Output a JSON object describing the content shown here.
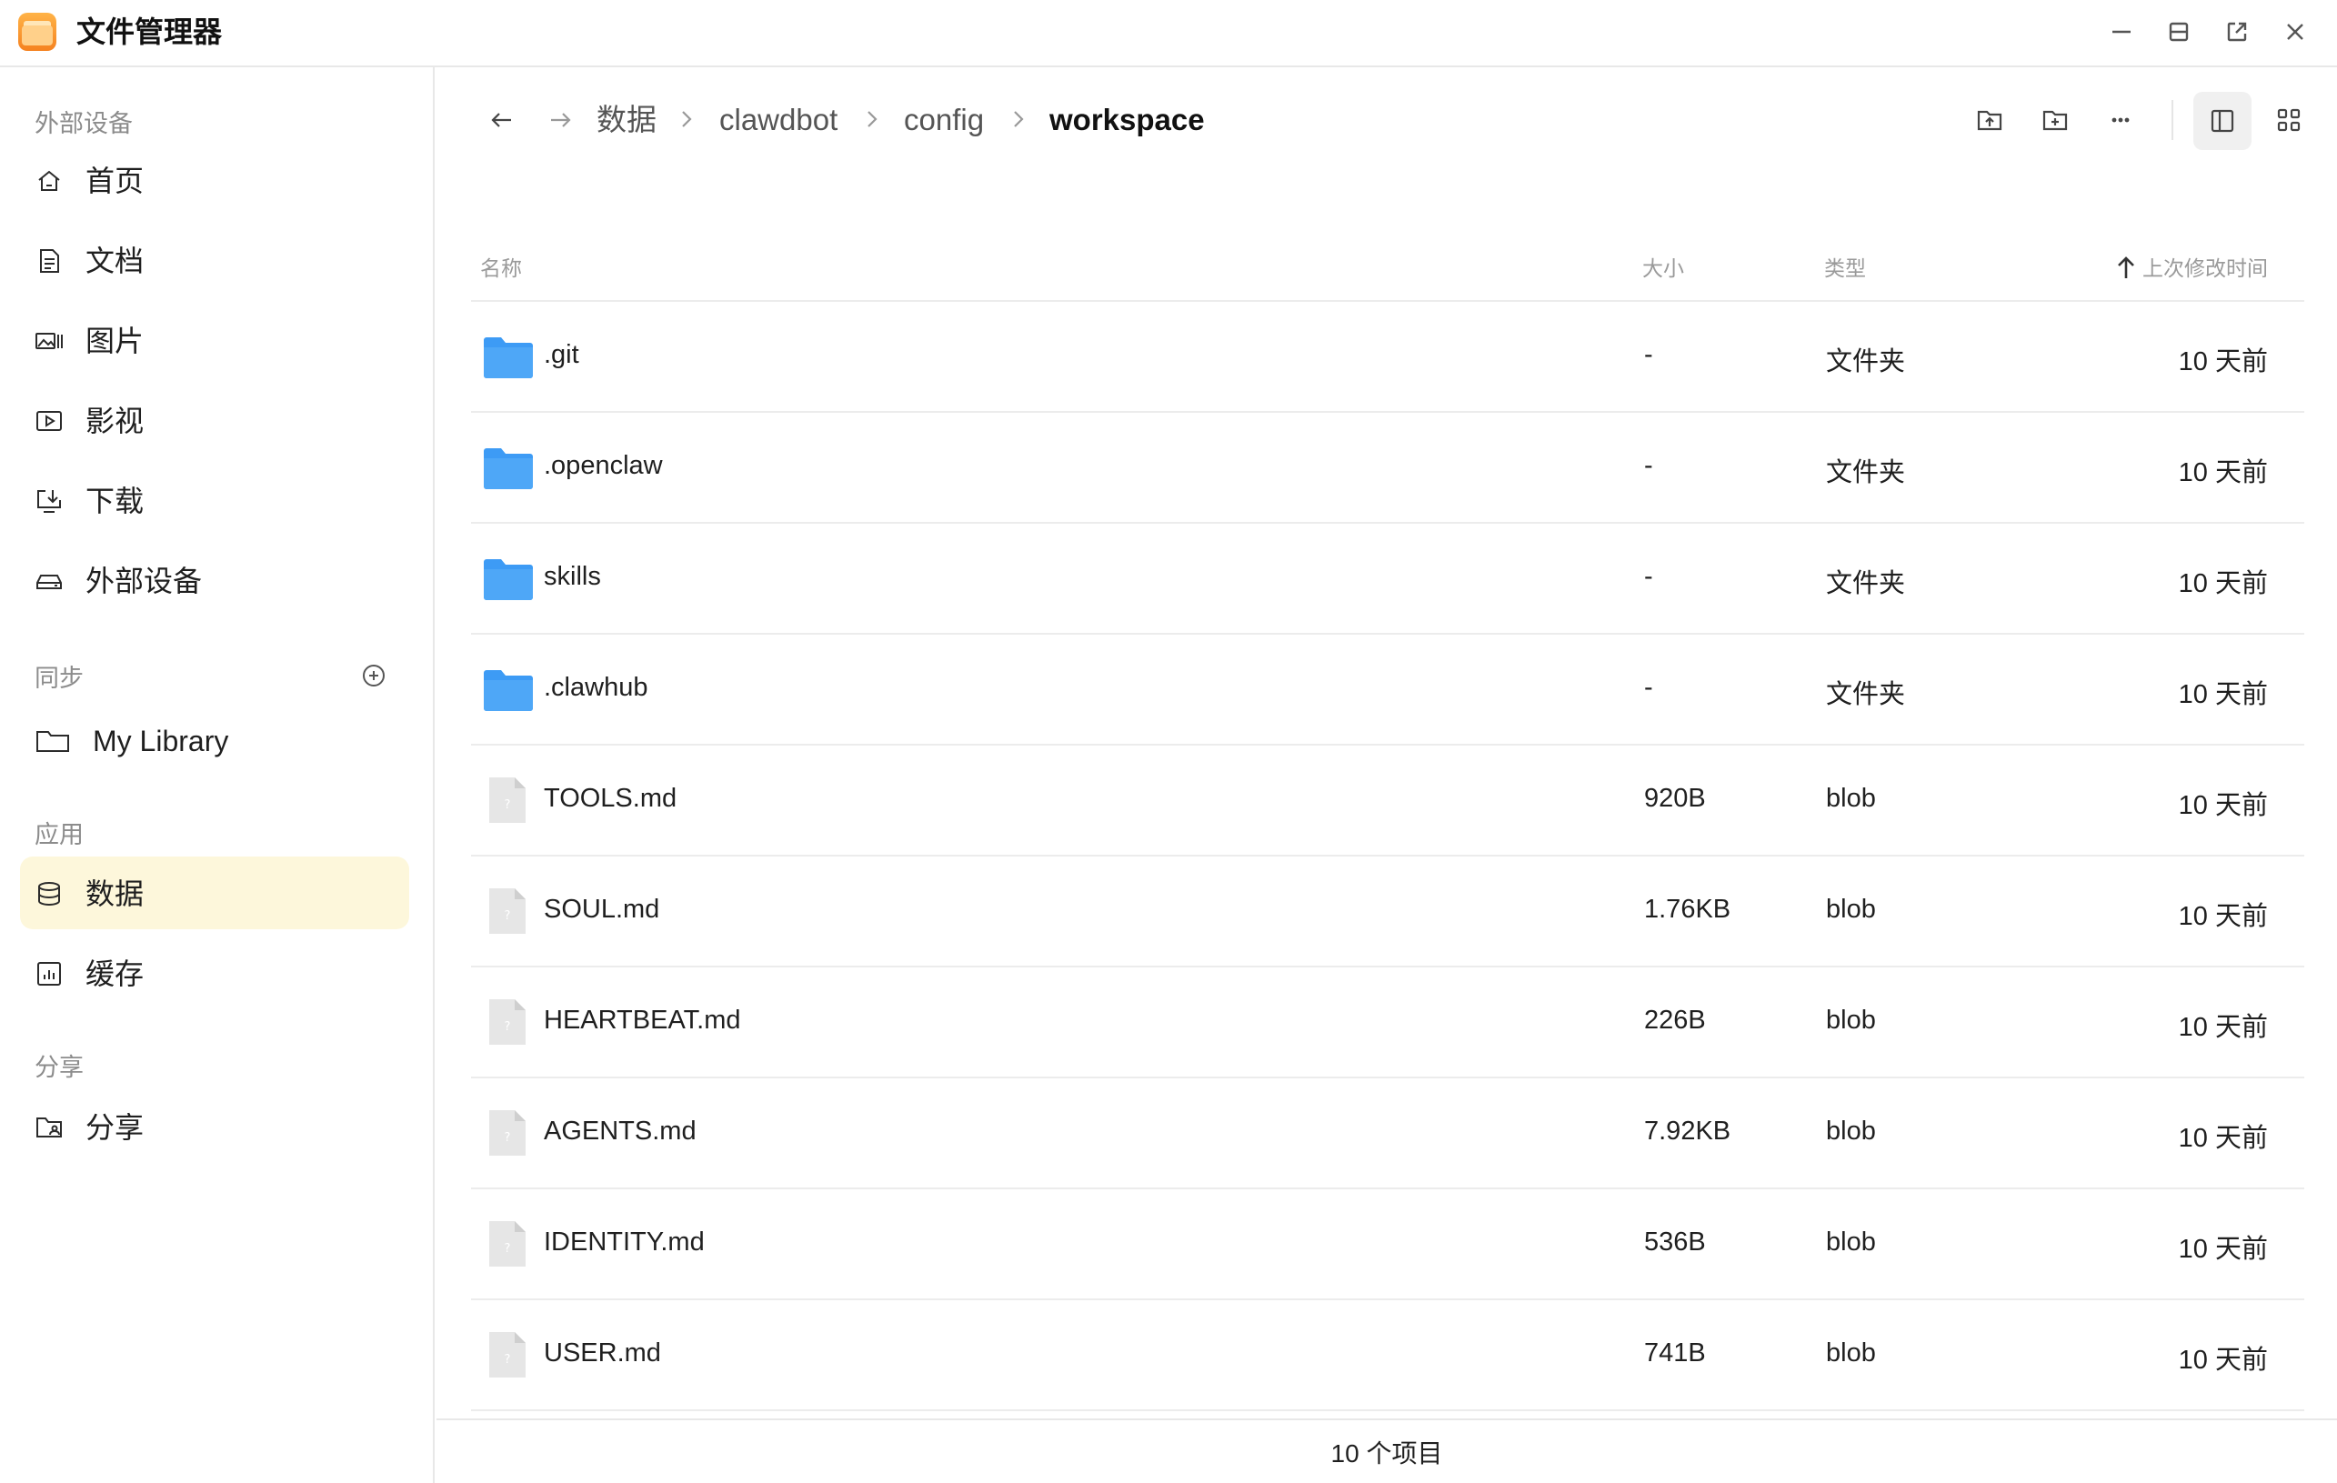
{
  "app": {
    "title": "文件管理器"
  },
  "sidebar": {
    "sections": {
      "external": "外部设备",
      "sync": "同步",
      "apps": "应用",
      "share": "分享"
    },
    "items": [
      {
        "label": "首页",
        "icon": "home-icon"
      },
      {
        "label": "文档",
        "icon": "document-icon"
      },
      {
        "label": "图片",
        "icon": "pictures-icon"
      },
      {
        "label": "影视",
        "icon": "video-icon"
      },
      {
        "label": "下载",
        "icon": "download-icon"
      },
      {
        "label": "外部设备",
        "icon": "drive-icon"
      }
    ],
    "sync_items": [
      {
        "label": "My Library",
        "icon": "folder-icon"
      }
    ],
    "app_items": [
      {
        "label": "数据",
        "icon": "database-icon",
        "active": true
      },
      {
        "label": "缓存",
        "icon": "cache-icon"
      }
    ],
    "share_items": [
      {
        "label": "分享",
        "icon": "shared-folder-icon"
      }
    ]
  },
  "breadcrumb": [
    "数据",
    "clawdbot",
    "config",
    "workspace"
  ],
  "table": {
    "headers": {
      "name": "名称",
      "size": "大小",
      "type": "类型",
      "modified": "上次修改时间"
    },
    "rows": [
      {
        "name": ".git",
        "size": "-",
        "type": "文件夹",
        "modified": "10 天前",
        "kind": "folder"
      },
      {
        "name": ".openclaw",
        "size": "-",
        "type": "文件夹",
        "modified": "10 天前",
        "kind": "folder"
      },
      {
        "name": "skills",
        "size": "-",
        "type": "文件夹",
        "modified": "10 天前",
        "kind": "folder"
      },
      {
        "name": ".clawhub",
        "size": "-",
        "type": "文件夹",
        "modified": "10 天前",
        "kind": "folder"
      },
      {
        "name": "TOOLS.md",
        "size": "920B",
        "type": "blob",
        "modified": "10 天前",
        "kind": "file"
      },
      {
        "name": "SOUL.md",
        "size": "1.76KB",
        "type": "blob",
        "modified": "10 天前",
        "kind": "file"
      },
      {
        "name": "HEARTBEAT.md",
        "size": "226B",
        "type": "blob",
        "modified": "10 天前",
        "kind": "file"
      },
      {
        "name": "AGENTS.md",
        "size": "7.92KB",
        "type": "blob",
        "modified": "10 天前",
        "kind": "file"
      },
      {
        "name": "IDENTITY.md",
        "size": "536B",
        "type": "blob",
        "modified": "10 天前",
        "kind": "file"
      },
      {
        "name": "USER.md",
        "size": "741B",
        "type": "blob",
        "modified": "10 天前",
        "kind": "file"
      }
    ]
  },
  "status": {
    "count_text": "10 个项目"
  },
  "colors": {
    "folder": "#3d9bf5",
    "active_nav_bg": "#fdf7db",
    "app_icon": "#f58220"
  }
}
